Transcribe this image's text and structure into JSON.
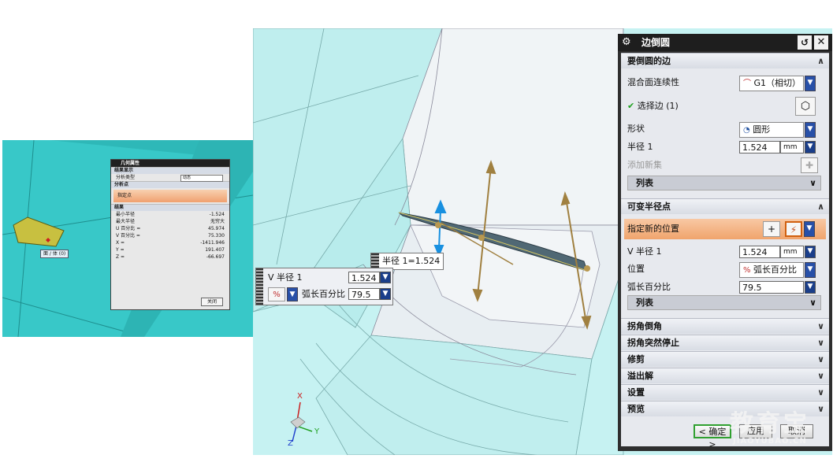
{
  "mini_dialog": {
    "title": "几何属性",
    "sec_display": "结果显示",
    "analysis_type_label": "分析类型",
    "analysis_type_value": "动态",
    "sec_point": "分析点",
    "specify_point": "指定点",
    "sec_result": "结果",
    "results": [
      {
        "k": "最小半径",
        "v": "-1.524"
      },
      {
        "k": "最大半径",
        "v": "无穷大"
      },
      {
        "k": "U 百分比 =",
        "v": "45.974"
      },
      {
        "k": "V 百分比 =",
        "v": "75.330"
      },
      {
        "k": "X =",
        "v": "-1411.946"
      },
      {
        "k": "Y =",
        "v": "191.407"
      },
      {
        "k": "Z =",
        "v": "-66.697"
      }
    ],
    "close_label": "关闭",
    "tag_label": "面 / 体 (0)"
  },
  "viewport": {
    "radius_tag": "半径 1=1.524",
    "float_v_radius_label": "V 半径 1",
    "float_v_radius_value": "1.524",
    "float_arc_label": "弧长百分比",
    "float_arc_value": "79.5",
    "axis_x": "X",
    "axis_y": "Y",
    "axis_z": "Z"
  },
  "dialog": {
    "title": "边倒圆",
    "sections": {
      "edges": "要倒圆的边",
      "variable": "可变半径点",
      "corner_setback": "拐角倒角",
      "corner_stop": "拐角突然停止",
      "trim": "修剪",
      "overflow": "溢出解",
      "settings": "设置",
      "preview": "预览"
    },
    "continuity_label": "混合面连续性",
    "continuity_value": "G1（相切）",
    "select_edge_label": "选择边 (1)",
    "shape_label": "形状",
    "shape_value": "圆形",
    "radius_label": "半径 1",
    "radius_value": "1.524",
    "radius_unit": "mm",
    "add_new_set": "添加新集",
    "list_label": "列表",
    "specify_location": "指定新的位置",
    "v_radius_label": "V 半径 1",
    "v_radius_value": "1.524",
    "v_radius_unit": "mm",
    "position_label": "位置",
    "position_value": "弧长百分比",
    "arc_percent_label": "弧长百分比",
    "arc_percent_value": "79.5",
    "list_label_2": "列表",
    "ok_label": "< 确定 >",
    "apply_label": "应用",
    "cancel_label": "取消"
  },
  "watermark": {
    "cn": "教育宝",
    "en": "JIAOYUBAO.CN"
  },
  "colors": {
    "cyan_surface": "#38c8c8",
    "light_surface": "#c8f4f4",
    "dialog_dark": "#2e2e2e",
    "highlight_orange": "#f0a46c",
    "arrow_gold": "#a08040",
    "arrow_blue": "#1890e0"
  }
}
